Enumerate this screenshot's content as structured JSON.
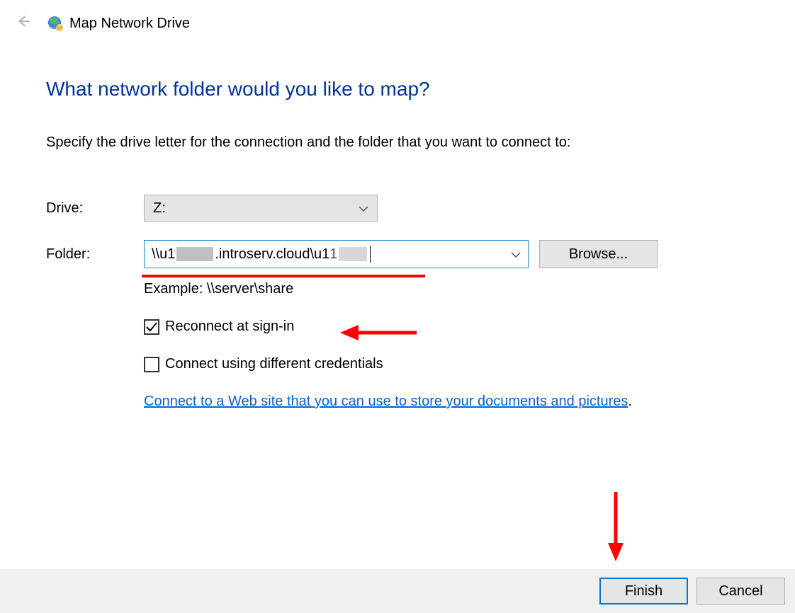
{
  "header": {
    "title": "Map Network Drive"
  },
  "main": {
    "heading": "What network folder would you like to map?",
    "instruction": "Specify the drive letter for the connection and the folder that you want to connect to:"
  },
  "form": {
    "drive_label": "Drive:",
    "drive_value": "Z:",
    "folder_label": "Folder:",
    "folder_value_prefix": "\\\\u1",
    "folder_value_mid": ".introserv.cloud\\u1",
    "browse_label": "Browse...",
    "example_text": "Example: \\\\server\\share",
    "reconnect_label": "Reconnect at sign-in",
    "reconnect_checked": true,
    "credentials_label": "Connect using different credentials",
    "credentials_checked": false,
    "website_link_text": "Connect to a Web site that you can use to store your documents and pictures"
  },
  "buttons": {
    "finish": "Finish",
    "cancel": "Cancel"
  },
  "annotations": {
    "underline_color": "#ff0000",
    "arrow_color": "#ff0000"
  }
}
